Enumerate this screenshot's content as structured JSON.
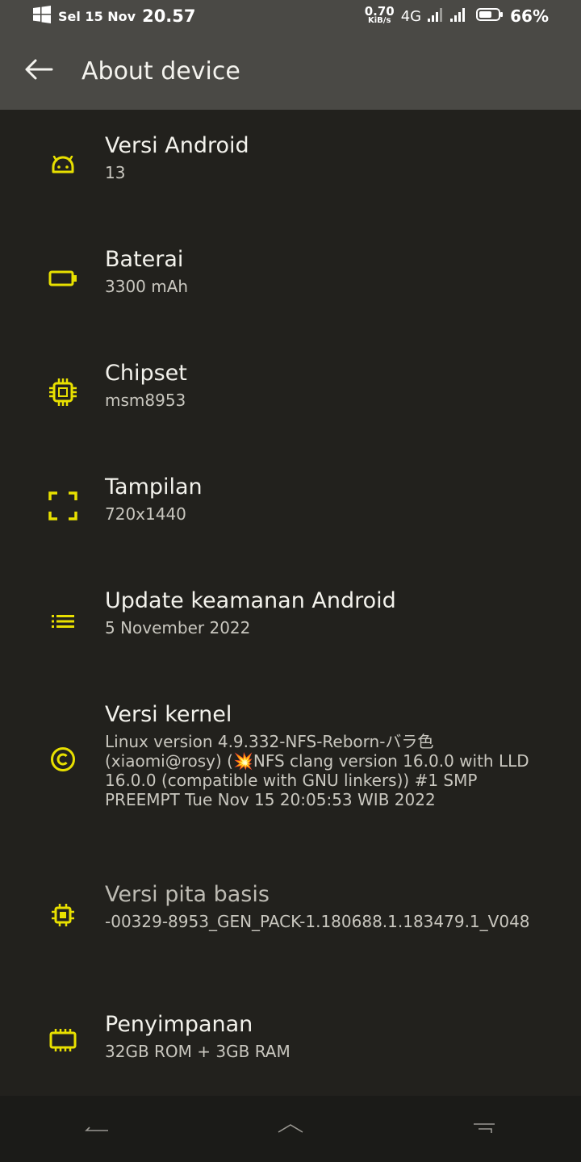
{
  "status_bar": {
    "date": "Sel 15 Nov",
    "time": "20.57",
    "speed_value": "0.70",
    "speed_unit": "KiB/s",
    "network": "4G",
    "battery_percent": "66%"
  },
  "app_bar": {
    "title": "About device"
  },
  "colors": {
    "accent": "#e8e000",
    "background": "#22211d",
    "appbar": "#4a4945"
  },
  "items": [
    {
      "icon": "android-icon",
      "title": "Versi Android",
      "summary": "13"
    },
    {
      "icon": "battery-icon",
      "title": "Baterai",
      "summary": "3300 mAh"
    },
    {
      "icon": "chip-icon",
      "title": "Chipset",
      "summary": "msm8953"
    },
    {
      "icon": "fullscreen-icon",
      "title": "Tampilan",
      "summary": "720x1440"
    },
    {
      "icon": "list-icon",
      "title": "Update keamanan Android",
      "summary": "5 November 2022"
    },
    {
      "icon": "copyright-icon",
      "title": "Versi kernel",
      "summary": "Linux version 4.9.332-NFS-Reborn-バラ色 (xiaomi@rosy) (💥NFS clang version 16.0.0 with LLD 16.0.0 (compatible with GNU linkers)) #1 SMP PREEMPT Tue Nov 15 20:05:53 WIB 2022"
    },
    {
      "icon": "baseband-chip-icon",
      "title": "Versi pita basis",
      "summary": "-00329-8953_GEN_PACK-1.180688.1.183479.1_V048"
    },
    {
      "icon": "storage-icon",
      "title": "Penyimpanan",
      "summary": "32GB ROM + 3GB RAM"
    }
  ]
}
